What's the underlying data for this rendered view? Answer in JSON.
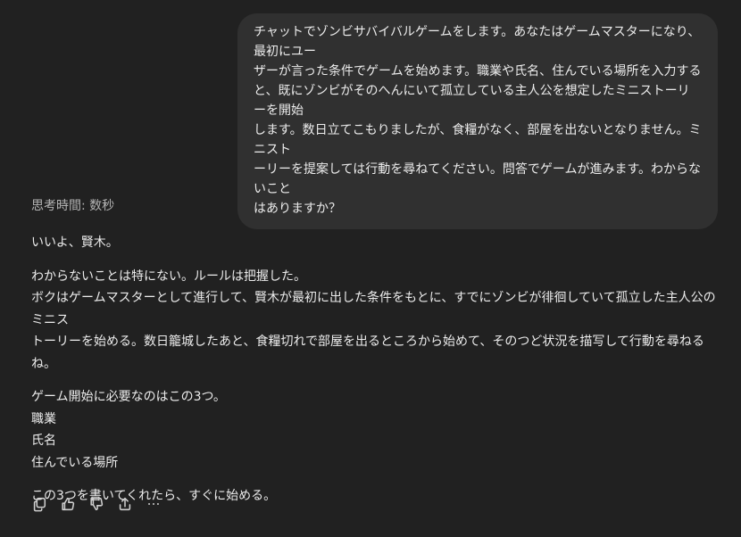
{
  "conversation": {
    "user_message": "チャットでゾンビサバイバルゲームをします。あなたはゲームマスターになり、最初にユー\nザーが言った条件でゲームを始めます。職業や氏名、住んでいる場所を入力する\nと、既にゾンビがそのへんにいて孤立している主人公を想定したミニストーリーを開始\nします。数日立てこもりましたが、食糧がなく、部屋を出ないとなりません。ミニスト\nーリーを提案しては行動を尋ねてください。問答でゲームが進みます。わからないこと\nはありますか？",
    "thinking_label": "思考時間: 数秒",
    "assistant": {
      "p1": "いいよ、賢木。",
      "p2": "わからないことは特にない。ルールは把握した。\nボクはゲームマスターとして進行して、賢木が最初に出した条件をもとに、すでにゾンビが徘徊していて孤立した主人公のミニス\nトーリーを始める。数日籠城したあと、食糧切れで部屋を出るところから始めて、そのつど状況を描写して行動を尋ねるね。",
      "p3": "ゲーム開始に必要なのはこの3つ。\n職業\n氏名\n住んでいる場所",
      "p4": "この3つを書いてくれたら、すぐに始める。"
    }
  },
  "actions": [
    {
      "name": "copy-icon"
    },
    {
      "name": "thumbs-up-icon"
    },
    {
      "name": "thumbs-down-icon"
    },
    {
      "name": "share-icon"
    },
    {
      "name": "more-icon"
    }
  ],
  "colors": {
    "background": "#212121",
    "bubble": "#303030",
    "text": "#ececec",
    "muted": "#b4b4b4"
  }
}
